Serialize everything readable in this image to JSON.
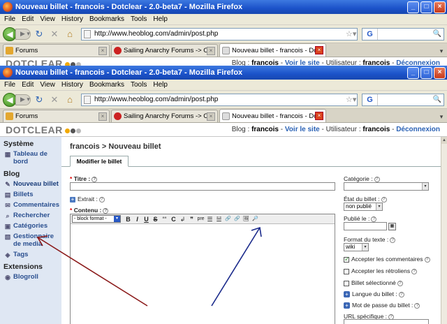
{
  "browser": {
    "window_title": "Nouveau billet - francois - Dotclear - 2.0-beta7 - Mozilla Firefox",
    "menu": [
      "File",
      "Edit",
      "View",
      "History",
      "Bookmarks",
      "Tools",
      "Help"
    ],
    "url": "http://www.heoblog.com/admin/post.php",
    "search_engine": "G",
    "tabs": [
      {
        "label": "Forums",
        "active": false
      },
      {
        "label": "Sailing Anarchy Forums -> Ocean Racin...",
        "active": false
      },
      {
        "label": "Nouveau billet - francois - Dotcle...",
        "active": true
      }
    ]
  },
  "dotclear": {
    "logo": "DOTCLEAR",
    "blog_label": "Blog :",
    "blog_name": "francois",
    "view_site": "Voir le site",
    "user_label": "Utilisateur :",
    "user_name": "francois",
    "logout": "Déconnexion"
  },
  "sidebar": {
    "systeme_heading": "Système",
    "systeme_items": [
      {
        "label": "Tableau de bord",
        "icon": "dashboard-icon"
      }
    ],
    "blog_heading": "Blog",
    "blog_items": [
      {
        "label": "Nouveau billet",
        "icon": "new-post-icon"
      },
      {
        "label": "Billets",
        "icon": "posts-icon"
      },
      {
        "label": "Commentaires",
        "icon": "comments-icon"
      },
      {
        "label": "Rechercher",
        "icon": "search-icon"
      },
      {
        "label": "Catégories",
        "icon": "categories-icon"
      },
      {
        "label": "Gestionnaire de media",
        "icon": "media-icon"
      },
      {
        "label": "Tags",
        "icon": "tags-icon"
      }
    ],
    "extensions_heading": "Extensions",
    "extensions_items": [
      {
        "label": "Blogroll",
        "icon": "blogroll-icon"
      }
    ]
  },
  "main": {
    "page_title": "francois > Nouveau billet",
    "subtab": "Modifier le billet",
    "title_label": "Titre :",
    "excerpt_label": "Extrait :",
    "content_label": "Contenu :",
    "block_format": "- block format -",
    "toolbar": [
      "B",
      "I",
      "U",
      "S",
      "““",
      "C",
      "↲",
      "❞",
      "pre",
      "☰",
      "☱",
      "🔗",
      "🔗",
      "🖼",
      "🔎"
    ]
  },
  "right": {
    "category_label": "Catégorie :",
    "category_value": "",
    "status_label": "État du billet :",
    "status_value": "non publié",
    "published_label": "Publié le :",
    "format_label": "Format du texte :",
    "format_value": "wiki",
    "accept_comments": "Accepter les commentaires",
    "accept_trackbacks": "Accepter les rétroliens",
    "selected_post": "Billet sélectionné",
    "language": "Langue du billet :",
    "password": "Mot de passe du billet :",
    "url": "URL spécifique :"
  },
  "annotation": {
    "arrow_color": "#8b1a1a",
    "arrow2_color": "#1a2a8b"
  }
}
